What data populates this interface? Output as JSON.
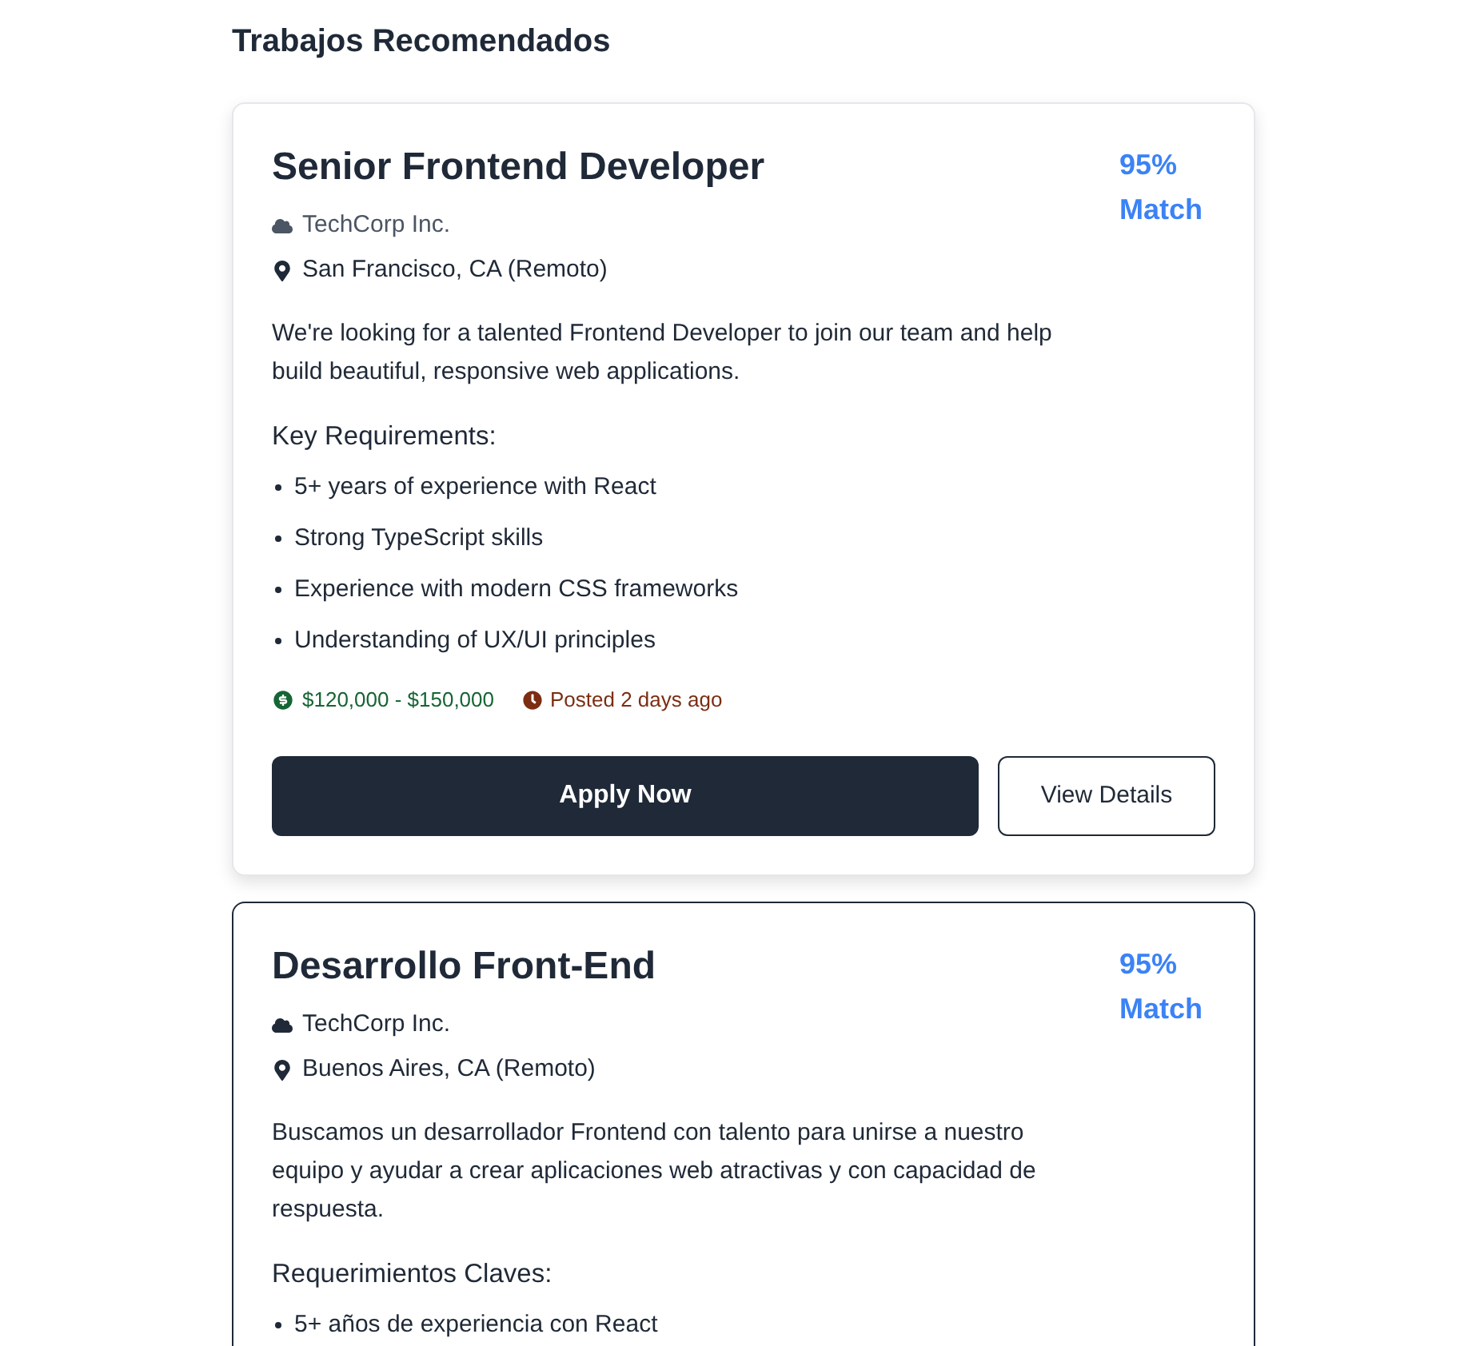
{
  "heading": "Trabajos Recomendados",
  "jobs": [
    {
      "selected": false,
      "title": "Senior Frontend Developer",
      "match": "95% Match",
      "company": "TechCorp Inc.",
      "location": "San Francisco, CA (Remoto)",
      "description": "We're looking for a talented Frontend Developer to join our team and help build beautiful, responsive web applications.",
      "requirements_title": "Key Requirements:",
      "requirements": [
        "5+ years of experience with React",
        "Strong TypeScript skills",
        "Experience with modern CSS frameworks",
        "Understanding of UX/UI principles"
      ],
      "salary": "$120,000 - $150,000",
      "posted": "Posted 2 days ago",
      "apply_button": "Apply Now",
      "details_button": "View Details"
    },
    {
      "selected": true,
      "title": "Desarrollo Front-End",
      "match": "95% Match",
      "company": "TechCorp Inc.",
      "location": "Buenos Aires, CA (Remoto)",
      "description": "Buscamos un desarrollador Frontend con talento para unirse a nuestro equipo y ayudar a crear aplicaciones web atractivas y con capacidad de respuesta.",
      "requirements_title": "Requerimientos Claves:",
      "requirements": [
        "5+ años de experiencia con React"
      ]
    }
  ]
}
